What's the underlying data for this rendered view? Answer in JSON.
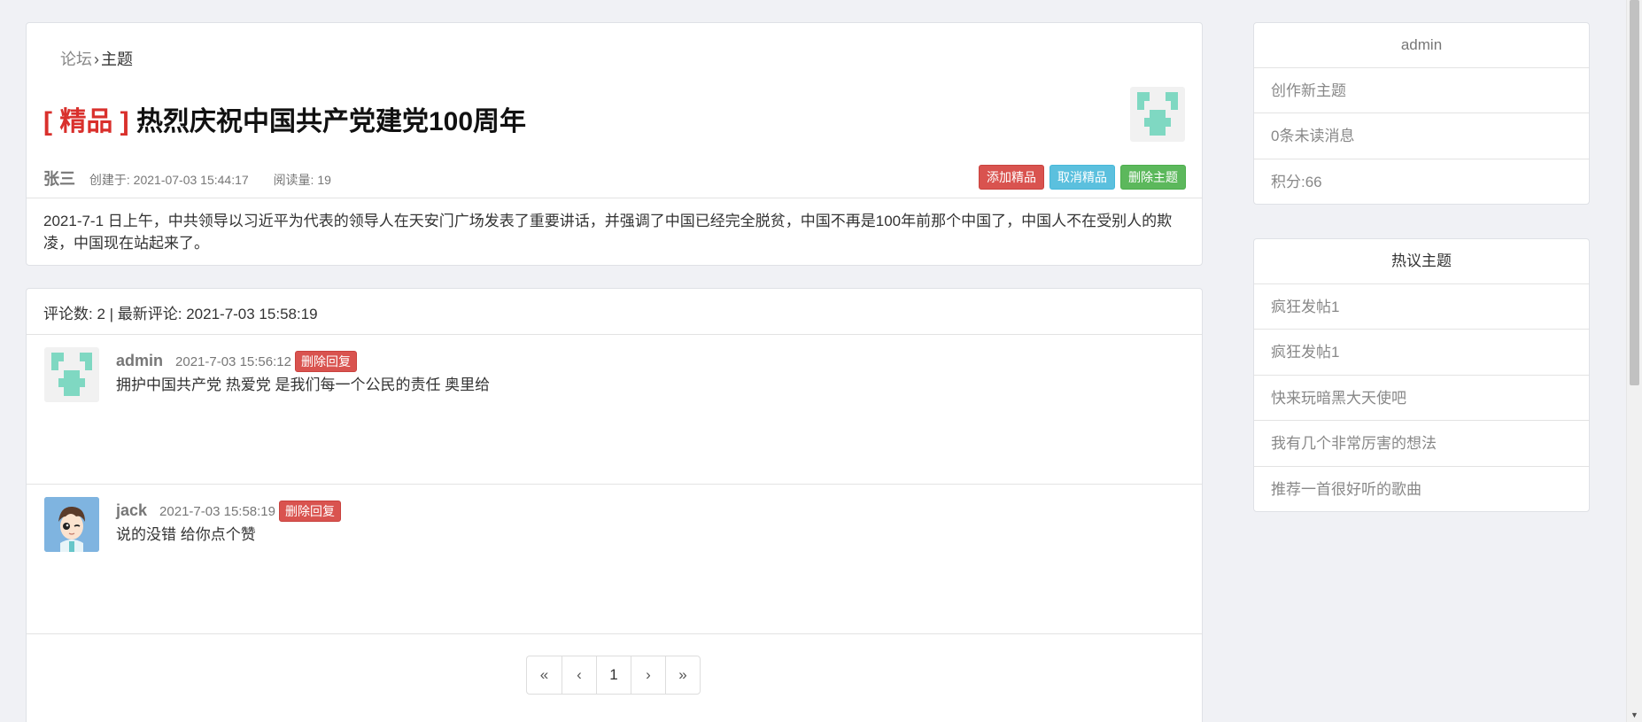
{
  "breadcrumb": {
    "forum": "论坛",
    "separator": "›",
    "current": "主题"
  },
  "topic": {
    "tag": "[ 精品 ]",
    "title": "热烈庆祝中国共产党建党100周年",
    "author": "张三",
    "created": "创建于: 2021-07-03 15:44:17",
    "views": "阅读量: 19",
    "buttons": {
      "add_featured": "添加精品",
      "cancel_featured": "取消精品",
      "delete_topic": "删除主题"
    },
    "body": "2021-7-1 日上午，中共领导以习近平为代表的领导人在天安门广场发表了重要讲话，并强调了中国已经完全脱贫，中国不再是100年前那个中国了，中国人不在受别人的欺凌，中国现在站起来了。"
  },
  "comments": {
    "summary": "评论数: 2 | 最新评论: 2021-7-03 15:58:19",
    "items": [
      {
        "user": "admin",
        "time": "2021-7-03 15:56:12",
        "delete_label": "删除回复",
        "text": "拥护中国共产党 热爱党 是我们每一个公民的责任 奥里给"
      },
      {
        "user": "jack",
        "time": "2021-7-03 15:58:19",
        "delete_label": "删除回复",
        "text": "说的没错 给你点个赞"
      }
    ],
    "pager": {
      "first": "«",
      "prev": "‹",
      "page": "1",
      "next": "›",
      "last": "»"
    }
  },
  "sidebar": {
    "user": {
      "name": "admin",
      "items": [
        "创作新主题",
        "0条未读消息",
        "积分:66"
      ]
    },
    "hot": {
      "title": "热议主题",
      "items": [
        "疯狂发帖1",
        "疯狂发帖1",
        "快来玩暗黑大天使吧",
        "我有几个非常厉害的想法",
        "推荐一首很好听的歌曲"
      ]
    }
  },
  "colors": {
    "featured_tag": "#d9302c",
    "danger": "#d9534f",
    "info": "#5bc0de",
    "success": "#5cb85c",
    "identicon": "#7fd8c2"
  }
}
